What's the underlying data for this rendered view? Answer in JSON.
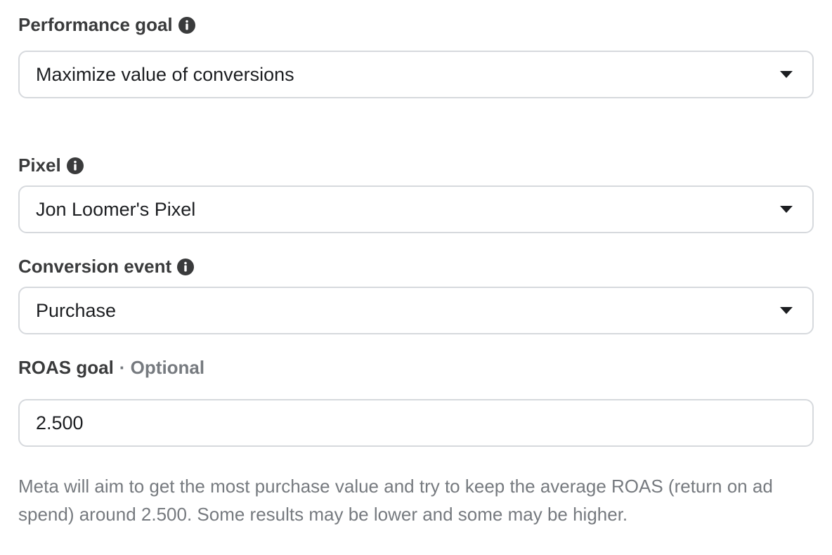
{
  "performance_goal": {
    "label": "Performance goal",
    "value": "Maximize value of conversions",
    "icon": "info-icon"
  },
  "pixel": {
    "label": "Pixel",
    "value": "Jon Loomer's Pixel",
    "icon": "info-icon"
  },
  "conversion_event": {
    "label": "Conversion event",
    "value": "Purchase",
    "icon": "info-icon"
  },
  "roas_goal": {
    "label": "ROAS goal",
    "optional_label": "· Optional",
    "value": "2.500"
  },
  "helper_text": "Meta will aim to get the most purchase value and try to keep the average ROAS (return on ad spend) around 2.500. Some results may be lower and some may be higher.",
  "colors": {
    "label": "#3a3b3c",
    "muted": "#767a7f",
    "border": "#d6d9dd",
    "text": "#1c1e21"
  }
}
